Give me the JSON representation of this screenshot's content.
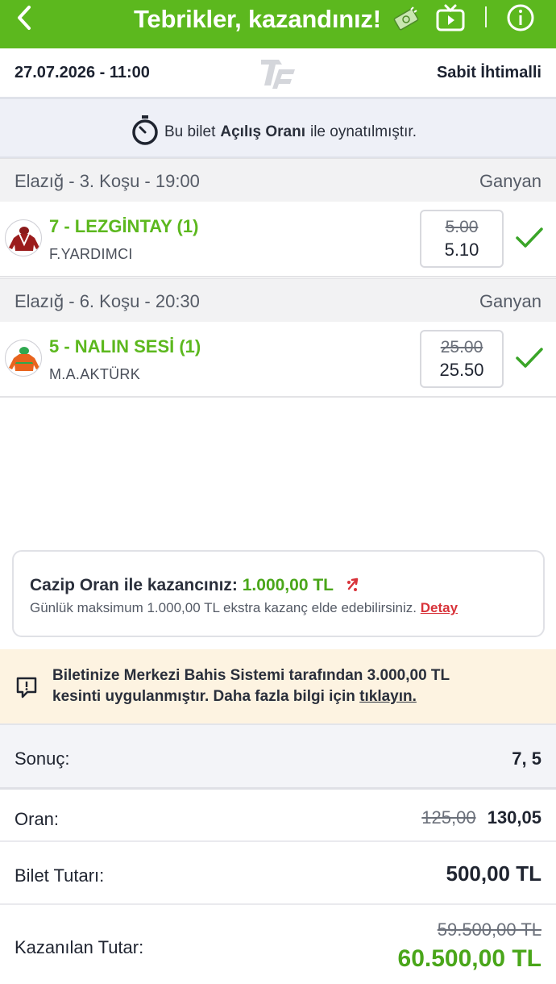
{
  "header": {
    "title": "Tebrikler, kazandınız!",
    "back_icon": "chevron-left-icon",
    "money_icon": "money-icon",
    "tv_icon": "tv-icon",
    "info_icon": "info-icon",
    "color": "#5cb81e"
  },
  "ticket": {
    "date": "27.07.2026 - 11:00",
    "type": "Sabit İhtimalli"
  },
  "opening_odds": {
    "prefix": "Bu bilet",
    "bold": "Açılış Oranı",
    "suffix": "ile oynatılmıştır."
  },
  "races": [
    {
      "name": "Elazığ - 3. Koşu - 19:00",
      "bet_type": "Ganyan",
      "horse": "7 - LEZGİNTAY (1)",
      "jockey": "F.YARDIMCI",
      "old_odds": "5.00",
      "new_odds": "5.10"
    },
    {
      "name": "Elazığ - 6. Koşu - 20:30",
      "bet_type": "Ganyan",
      "horse": "5 - NALIN SESİ (1)",
      "jockey": "M.A.AKTÜRK",
      "old_odds": "25.00",
      "new_odds": "25.50"
    }
  ],
  "cazip": {
    "label": "Cazip Oran ile kazancınız:",
    "amount": "1.000,00 TL",
    "desc": "Günlük maksimum 1.000,00 TL ekstra kazanç elde edebilirsiniz.",
    "detail_link": "Detay"
  },
  "warning": {
    "part1": "Biletinize Merkezi Bahis Sistemi tarafından",
    "amount": "3.000,00 TL",
    "part2": "kesinti uygulanmıştır. Daha fazla bilgi için",
    "link": "tıklayın."
  },
  "summary": {
    "result_label": "Sonuç:",
    "result_value": "7, 5",
    "odds_label": "Oran:",
    "odds_old": "125,00",
    "odds_new": "130,05",
    "stake_label": "Bilet Tutarı:",
    "stake_value": "500,00 TL",
    "win_label": "Kazanılan Tutar:",
    "win_old": "59.500,00 TL",
    "win_new": "60.500,00 TL"
  }
}
